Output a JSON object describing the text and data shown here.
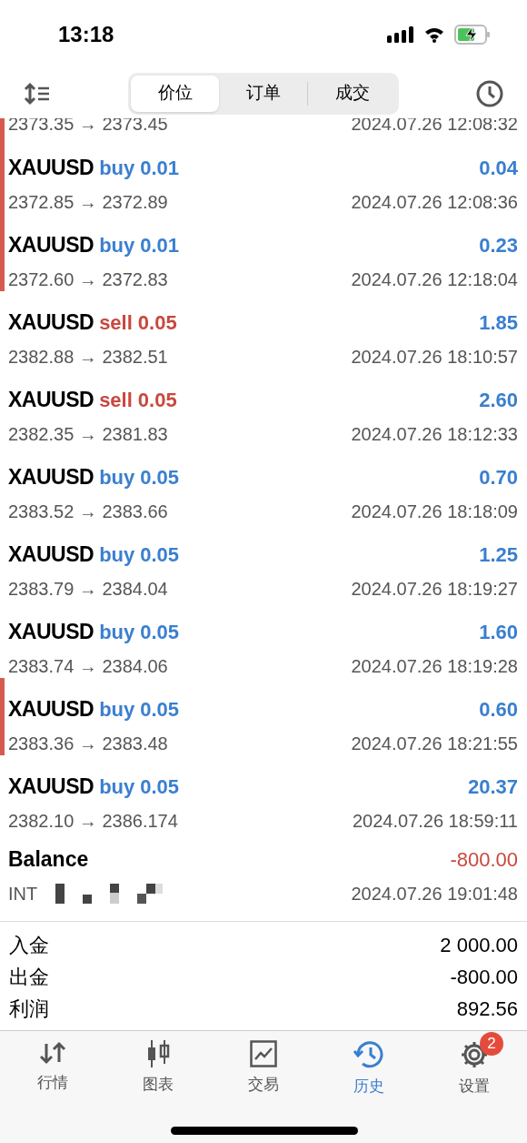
{
  "status_bar": {
    "time": "13:18"
  },
  "segments": [
    {
      "label": "价位",
      "selected": true
    },
    {
      "label": "订单",
      "selected": false
    },
    {
      "label": "成交",
      "selected": false
    }
  ],
  "partial_row": {
    "prices": "2373.35 → 2373.45",
    "time": "2024.07.26 12:08:32",
    "marked": true
  },
  "deals": [
    {
      "symbol": "XAUUSD",
      "side": "buy",
      "volume": "0.01",
      "profit": "0.04",
      "prices": "2372.85 → 2372.89",
      "time": "2024.07.26 12:08:36",
      "marked": true
    },
    {
      "symbol": "XAUUSD",
      "side": "buy",
      "volume": "0.01",
      "profit": "0.23",
      "prices": "2372.60 → 2372.83",
      "time": "2024.07.26 12:18:04",
      "marked": true
    },
    {
      "symbol": "XAUUSD",
      "side": "sell",
      "volume": "0.05",
      "profit": "1.85",
      "prices": "2382.88 → 2382.51",
      "time": "2024.07.26 18:10:57",
      "marked": false
    },
    {
      "symbol": "XAUUSD",
      "side": "sell",
      "volume": "0.05",
      "profit": "2.60",
      "prices": "2382.35 → 2381.83",
      "time": "2024.07.26 18:12:33",
      "marked": false
    },
    {
      "symbol": "XAUUSD",
      "side": "buy",
      "volume": "0.05",
      "profit": "0.70",
      "prices": "2383.52 → 2383.66",
      "time": "2024.07.26 18:18:09",
      "marked": false
    },
    {
      "symbol": "XAUUSD",
      "side": "buy",
      "volume": "0.05",
      "profit": "1.25",
      "prices": "2383.79 → 2384.04",
      "time": "2024.07.26 18:19:27",
      "marked": false
    },
    {
      "symbol": "XAUUSD",
      "side": "buy",
      "volume": "0.05",
      "profit": "1.60",
      "prices": "2383.74 → 2384.06",
      "time": "2024.07.26 18:19:28",
      "marked": false
    },
    {
      "symbol": "XAUUSD",
      "side": "buy",
      "volume": "0.05",
      "profit": "0.60",
      "prices": "2383.36 → 2383.48",
      "time": "2024.07.26 18:21:55",
      "marked": true
    },
    {
      "symbol": "XAUUSD",
      "side": "buy",
      "volume": "0.05",
      "profit": "20.37",
      "prices": "2382.10 → 2386.174",
      "time": "2024.07.26 18:59:11",
      "marked": false
    }
  ],
  "balance": {
    "title": "Balance",
    "amount": "-800.00",
    "comment": "INT",
    "time": "2024.07.26 19:01:48"
  },
  "summary": [
    {
      "label": "入金",
      "value": "2 000.00"
    },
    {
      "label": "出金",
      "value": "-800.00"
    },
    {
      "label": "利润",
      "value": "892.56"
    }
  ],
  "tab_bar": [
    {
      "kind": "quotes",
      "label": "行情",
      "selected": false
    },
    {
      "kind": "chart",
      "label": "图表",
      "selected": false
    },
    {
      "kind": "trade",
      "label": "交易",
      "selected": false
    },
    {
      "kind": "history",
      "label": "历史",
      "selected": true
    },
    {
      "kind": "settings",
      "label": "设置",
      "selected": false,
      "badge": "2"
    }
  ]
}
